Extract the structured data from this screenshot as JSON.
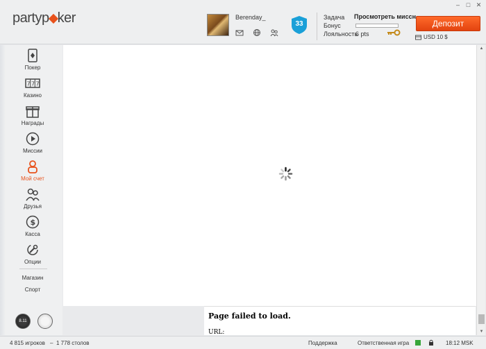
{
  "app": {
    "logo_part1": "party",
    "logo_part2": "p",
    "logo_part3": "ker"
  },
  "colors": {
    "accent": "#e8521c",
    "badge": "#1aa0d8",
    "online": "#37a63a"
  },
  "header": {
    "username": "Berenday_",
    "level": "33",
    "labels": {
      "task": "Задача",
      "bonus": "Бонус",
      "loyalty": "Лояльность"
    },
    "mission_link": "Просмотреть миссн",
    "bonus_progress": 0,
    "loyalty_value": "6 pts",
    "deposit_label": "Депозит",
    "balance": "USD 10 $"
  },
  "sidebar": {
    "items": [
      {
        "label": "Покер",
        "icon": "poker-card-icon"
      },
      {
        "label": "Казино",
        "icon": "slot-777-icon"
      },
      {
        "label": "Награды",
        "icon": "gift-icon"
      },
      {
        "label": "Миссии",
        "icon": "play-circle-icon"
      },
      {
        "label": "Мой счет",
        "icon": "user-icon",
        "active": true
      },
      {
        "label": "Друзья",
        "icon": "friends-icon"
      },
      {
        "label": "Касса",
        "icon": "dollar-icon"
      },
      {
        "label": "Опции",
        "icon": "wrench-icon"
      }
    ],
    "text_links": [
      "Магазин",
      "Спорт"
    ],
    "chips": [
      "8.11",
      ""
    ]
  },
  "content": {
    "error_title": "Page failed to load.",
    "error_url": "URL:"
  },
  "statusbar": {
    "players": "4 815 игроков",
    "separator": "–",
    "tables": "1 778 столов",
    "support": "Поддержка",
    "responsible": "Ответственная игра",
    "time": "18:12 MSK"
  }
}
